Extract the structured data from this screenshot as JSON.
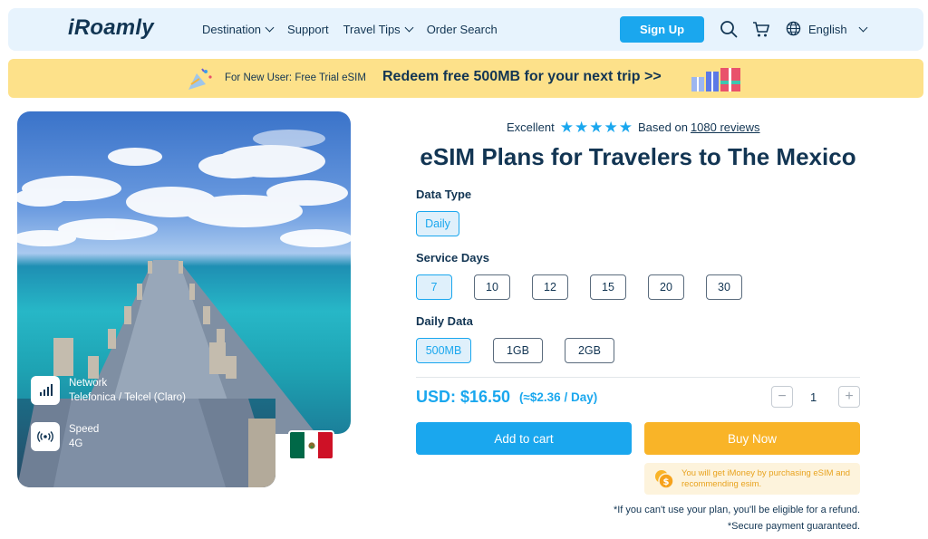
{
  "header": {
    "logo": "iRoamly",
    "nav": [
      {
        "label": "Destination",
        "dropdown": true
      },
      {
        "label": "Support",
        "dropdown": false
      },
      {
        "label": "Travel Tips",
        "dropdown": true
      },
      {
        "label": "Order Search",
        "dropdown": false
      }
    ],
    "signup_label": "Sign Up",
    "language": "English",
    "icons": [
      "search-icon",
      "cart-icon",
      "globe-icon"
    ]
  },
  "promo": {
    "small_text": "For New User: Free Trial eSIM",
    "big_text": "Redeem free 500MB for your next trip >>"
  },
  "hero": {
    "network_label": "Network",
    "network_value": "Telefonica / Telcel (Claro)",
    "speed_label": "Speed",
    "speed_value": "4G",
    "flag_colors": [
      "#006847",
      "#ffffff",
      "#ce1126"
    ]
  },
  "rating": {
    "label": "Excellent",
    "stars": 5,
    "based_on": "Based on",
    "reviews_link": "1080 reviews"
  },
  "title": "eSIM Plans for Travelers to The Mexico",
  "data_type": {
    "label": "Data Type",
    "options": [
      "Daily"
    ],
    "selected": "Daily"
  },
  "service_days": {
    "label": "Service Days",
    "options": [
      "7",
      "10",
      "12",
      "15",
      "20",
      "30"
    ],
    "selected": "7"
  },
  "daily_data": {
    "label": "Daily Data",
    "options": [
      "500MB",
      "1GB",
      "2GB"
    ],
    "selected": "500MB"
  },
  "purchase": {
    "price": "USD: $16.50",
    "per_day": "(≈$2.36 / Day)",
    "minus": "−",
    "plus": "+",
    "quantity": "1",
    "add_to_cart": "Add to cart",
    "buy_now": "Buy Now",
    "imoney_text": "You will get iMoney by purchasing eSIM and recommending esim.",
    "refund_note": "*If you can't use your plan, you'll be eligible for a refund.",
    "secure_note": "*Secure payment guaranteed."
  },
  "colors": {
    "accent": "#1aa7ee",
    "buy_now": "#f9b428",
    "promo_bg": "#fde18a",
    "header_bg": "#e7f3fd",
    "text": "#123553"
  }
}
